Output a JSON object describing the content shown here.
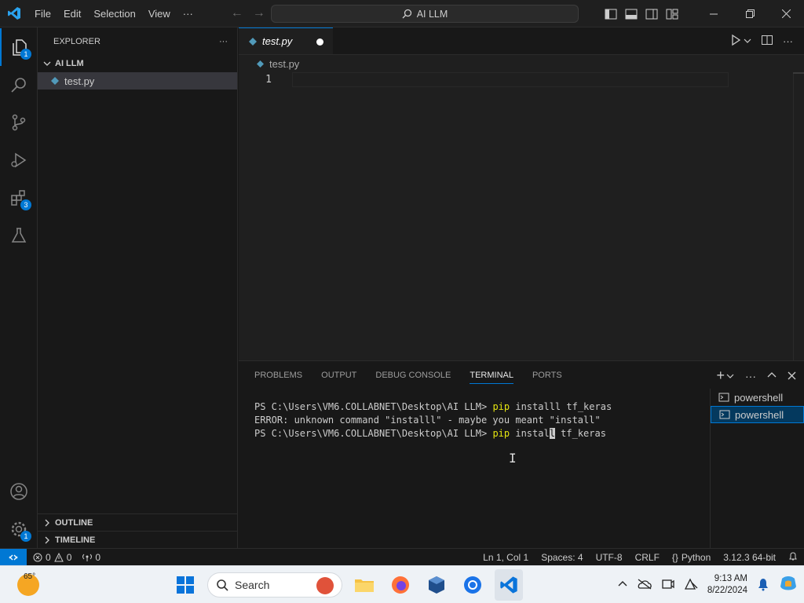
{
  "menu": [
    "File",
    "Edit",
    "Selection",
    "View",
    "···"
  ],
  "command_center": "AI LLM",
  "activity": {
    "explorer_badge": "1",
    "extensions_badge": "3",
    "settings_badge": "1"
  },
  "sidebar": {
    "title": "EXPLORER",
    "more": "···",
    "folder": "AI LLM",
    "file": "test.py",
    "outline": "OUTLINE",
    "timeline": "TIMELINE"
  },
  "editor": {
    "tab": "test.py",
    "breadcrumb": "test.py",
    "line_number": "1"
  },
  "panel": {
    "tabs": [
      "PROBLEMS",
      "OUTPUT",
      "DEBUG CONSOLE",
      "TERMINAL",
      "PORTS"
    ],
    "active_tab": "TERMINAL",
    "terminal": {
      "prompt": "PS C:\\Users\\VM6.COLLABNET\\Desktop\\AI LLM> ",
      "line1_cmd": "pip",
      "line1_rest": " installl tf_keras",
      "line2": "ERROR: unknown command \"installl\" - maybe you meant \"install\"",
      "line3_cmd": "pip",
      "line3_pre": " instal",
      "line3_cursor": "l",
      "line3_post": " tf_keras"
    },
    "terminals": [
      "powershell",
      "powershell"
    ]
  },
  "status": {
    "errors": "0",
    "warnings": "0",
    "ports": "0",
    "position": "Ln 1, Col 1",
    "spaces": "Spaces: 4",
    "encoding": "UTF-8",
    "eol": "CRLF",
    "language": "Python",
    "interpreter": "3.12.3 64-bit"
  },
  "taskbar": {
    "temperature": "65°",
    "search_placeholder": "Search",
    "time": "9:13 AM",
    "date": "8/22/2024"
  },
  "colors": {
    "accent": "#0078d4",
    "bg": "#1f1f1f",
    "taskbar": "#eef2f6"
  }
}
